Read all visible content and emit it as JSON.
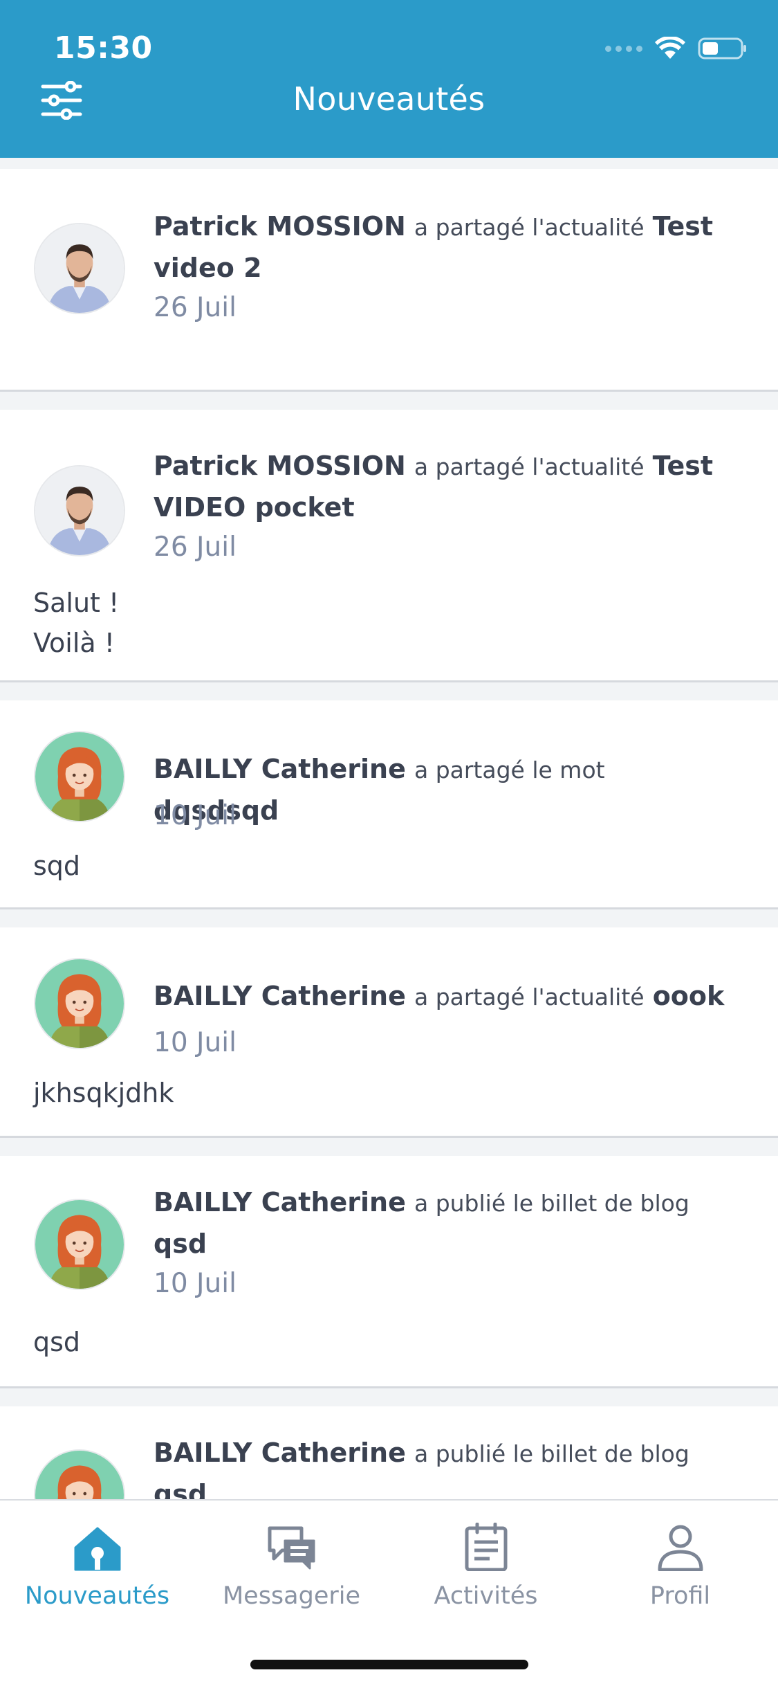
{
  "status_bar": {
    "time": "15:30"
  },
  "header": {
    "title": "Nouveautés"
  },
  "feed": [
    {
      "name": "Patrick MOSSION",
      "action": "a partagé l'actualité",
      "target": "Test video 2",
      "date": "26 Juil",
      "body": "",
      "avatar": "man-avatar"
    },
    {
      "name": "Patrick MOSSION",
      "action": "a partagé l'actualité",
      "target": "Test VIDEO pocket",
      "date": "26 Juil",
      "body": "Salut ! Voilà !",
      "body_lines": [
        "Salut !",
        "Voilà !"
      ],
      "avatar": "man-avatar"
    },
    {
      "name": "BAILLY Catherine",
      "action": "a partagé le mot",
      "target": "dqsdsqd",
      "date": "10 Juil",
      "body": "sqd",
      "avatar": "woman-avatar"
    },
    {
      "name": "BAILLY Catherine",
      "action": "a partagé l'actualité",
      "target": "oook",
      "date": "10 Juil",
      "body": "jkhsqkjdhk",
      "avatar": "woman-avatar"
    },
    {
      "name": "BAILLY Catherine",
      "action": "a publié le billet de blog",
      "target": "qsd",
      "date": "10 Juil",
      "body": "qsd",
      "avatar": "woman-avatar"
    },
    {
      "name": "BAILLY Catherine",
      "action": "a publié le billet de blog",
      "target": "qsd",
      "date": "",
      "body": "",
      "avatar": "woman-avatar"
    }
  ],
  "tabs": [
    {
      "label": "Nouveautés",
      "icon": "home-icon",
      "active": true
    },
    {
      "label": "Messagerie",
      "icon": "chat-icon",
      "active": false
    },
    {
      "label": "Activités",
      "icon": "clipboard-icon",
      "active": false
    },
    {
      "label": "Profil",
      "icon": "profile-icon",
      "active": false
    }
  ],
  "colors": {
    "header": "#2b9bc9",
    "active_tab": "#2b9bc9",
    "date": "#7f8ba3"
  }
}
